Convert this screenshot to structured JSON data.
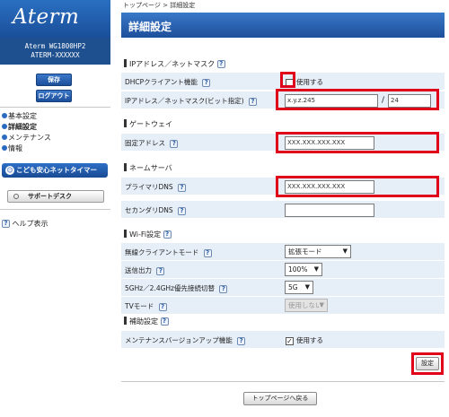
{
  "sidebar": {
    "logo": "Aterm",
    "model_line1": "Aterm WG1800HP2",
    "model_line2": "ATERM-XXXXXX",
    "save_label": "保存",
    "logout_label": "ログアウト",
    "nav": [
      {
        "label": "基本設定"
      },
      {
        "label": "詳細設定"
      },
      {
        "label": "メンテナンス"
      },
      {
        "label": "情報"
      }
    ],
    "kids_timer_label": "こども安心ネットタイマー",
    "support_label": "サポートデスク",
    "help_label": "ヘルプ表示"
  },
  "breadcrumb": {
    "top": "トップページ",
    "sep": ">",
    "current": "詳細設定"
  },
  "page_title": "詳細設定",
  "help_icon_glyph": "?",
  "sections": {
    "ip": {
      "title": "IPアドレス／ネットマスク",
      "dhcp_label": "DHCPクライアント機能",
      "dhcp_checkbox_label": "使用する",
      "ip_label": "IPアドレス／ネットマスク(ビット指定)",
      "ip_value": "x.y.z.245",
      "slash": "/",
      "mask_value": "24"
    },
    "gateway": {
      "title": "ゲートウェイ",
      "fixed_label": "固定アドレス",
      "fixed_value": "XXX.XXX.XXX.XXX"
    },
    "dns": {
      "title": "ネームサーバ",
      "primary_label": "プライマリDNS",
      "primary_value": "XXX.XXX.XXX.XXX",
      "secondary_label": "セカンダリDNS",
      "secondary_value": ""
    },
    "wifi": {
      "title": "Wi-Fi設定",
      "mode_label": "無線クライアントモード",
      "mode_value": "拡張モード",
      "power_label": "送信出力",
      "power_value": "100%",
      "band_label": "5GHz／2.4GHz優先接続切替",
      "band_value": "5G",
      "tv_label": "TVモード",
      "tv_value": "使用しない"
    },
    "aux": {
      "title": "補助設定",
      "maint_label": "メンテナンスバージョンアップ機能",
      "maint_checkbox_label": "使用する",
      "maint_checked": "✓"
    }
  },
  "buttons": {
    "set": "設定",
    "back_to_top": "トップページへ戻る"
  },
  "colors": {
    "header_blue": "#1d4f9b",
    "row_bg": "#e6eef8",
    "highlight_red": "#e0001a"
  }
}
